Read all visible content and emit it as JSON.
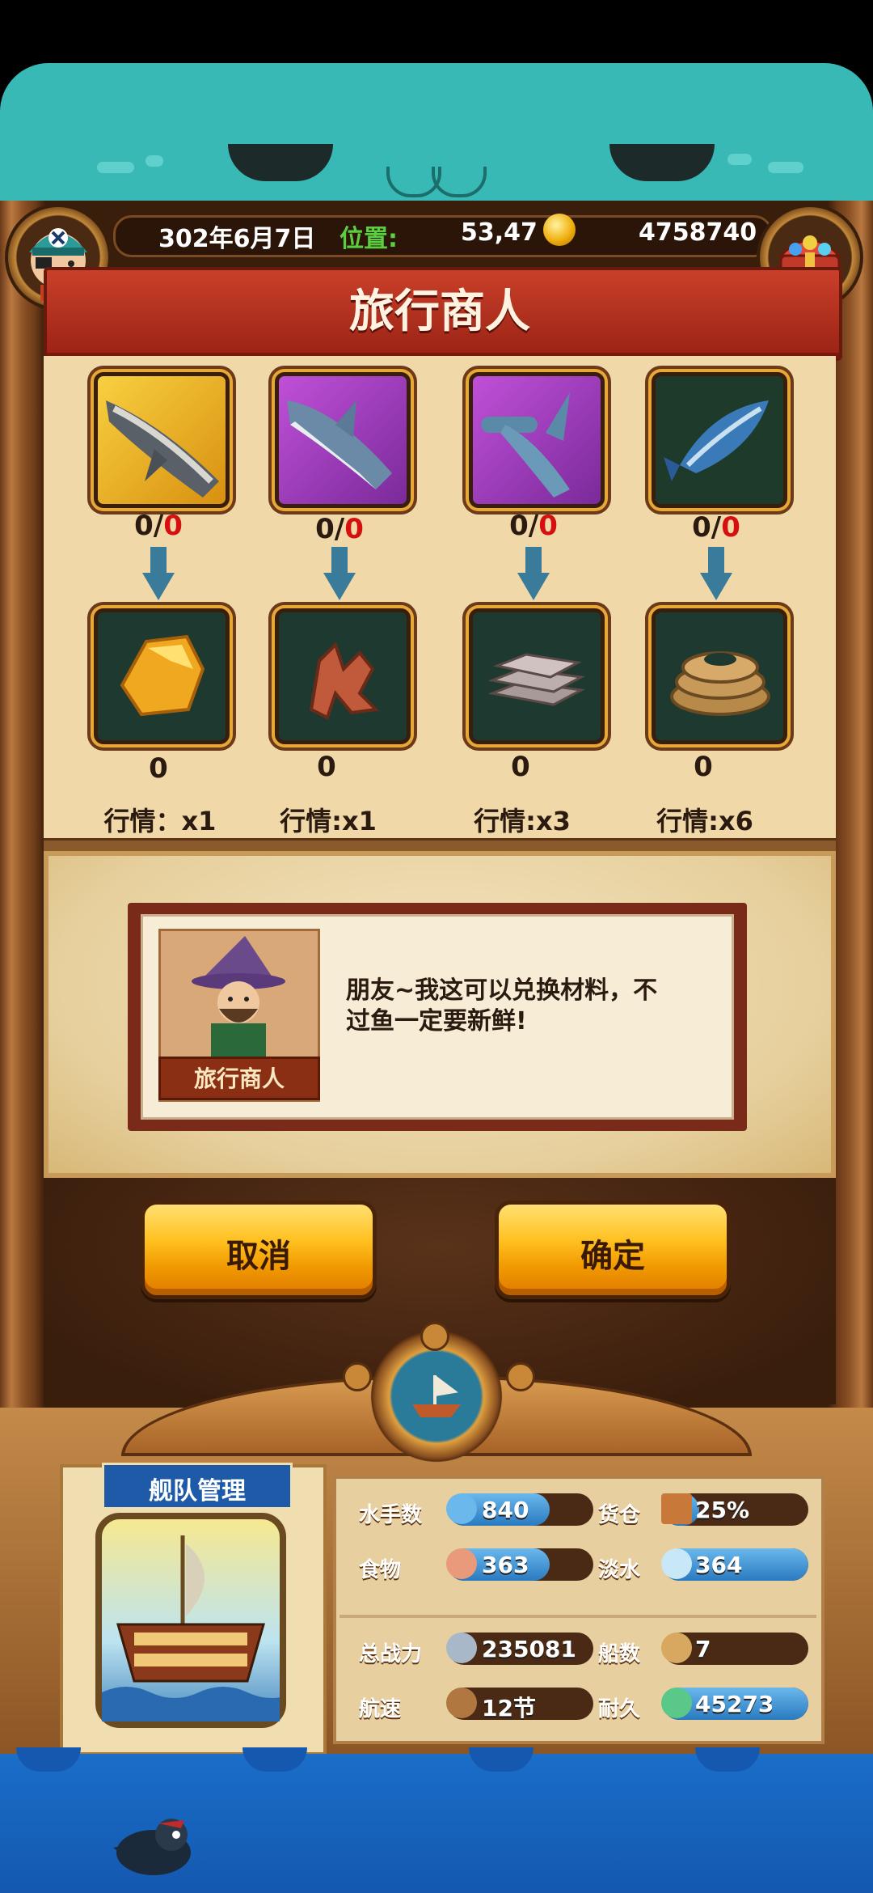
{
  "header": {
    "date": "302年6月7日",
    "position_label": "位置:",
    "position_value": "53,47",
    "gold": "4758740"
  },
  "title": "旅行商人",
  "exchange": [
    {
      "fish_icon": "whale-icon",
      "fish_bg": "#e8b820",
      "count_have": "0/",
      "count_need": "0",
      "material_icon": "gold-nugget-icon",
      "material_amount": "0",
      "market": "行情：x1"
    },
    {
      "fish_icon": "shark-icon",
      "fish_bg": "#9a3ab0",
      "count_have": "0/",
      "count_need": "0",
      "material_icon": "coral-icon",
      "material_amount": "0",
      "market": "行情:x1"
    },
    {
      "fish_icon": "hammerhead-shark-icon",
      "fish_bg": "#9a3ab0",
      "count_have": "0/",
      "count_need": "0",
      "material_icon": "iron-ingot-icon",
      "material_amount": "0",
      "market": "行情:x3"
    },
    {
      "fish_icon": "tuna-icon",
      "fish_bg": "#1e3a2a",
      "count_have": "0/",
      "count_need": "0",
      "material_icon": "rope-icon",
      "material_amount": "0",
      "market": "行情:x6"
    }
  ],
  "dialog": {
    "npc_name": "旅行商人",
    "line1": "朋友~我这可以兑换材料，不",
    "line2": "过鱼一定要新鲜!"
  },
  "buttons": {
    "cancel": "取消",
    "confirm": "确定"
  },
  "fleet": {
    "tag": "舰队管理",
    "stats": [
      {
        "label": "水手数",
        "icon": "sailor-icon",
        "value": "840",
        "fill": 0.7
      },
      {
        "label": "货仓",
        "icon": "cargo-crate-icon",
        "value": "25%",
        "fill": 0.25
      },
      {
        "label": "食物",
        "icon": "meat-icon",
        "value": "363",
        "fill": 0.7
      },
      {
        "label": "淡水",
        "icon": "water-jug-icon",
        "value": "364",
        "fill": 1.0
      },
      {
        "label": "总战力",
        "icon": "crossed-swords-icon",
        "value": "235081",
        "fill": 0
      },
      {
        "label": "船数",
        "icon": "ship-count-icon",
        "value": "7",
        "fill": 0
      },
      {
        "label": "航速",
        "icon": "sail-ship-icon",
        "value": "12节",
        "fill": 0
      },
      {
        "label": "耐久",
        "icon": "durability-ship-icon",
        "value": "45273",
        "fill": 1.0
      }
    ]
  },
  "colors": {
    "accent_red": "#d41010",
    "button_orange": "#ffc020",
    "bar_blue": "#2a7ac0",
    "sea_blue": "#1a6ec8"
  }
}
